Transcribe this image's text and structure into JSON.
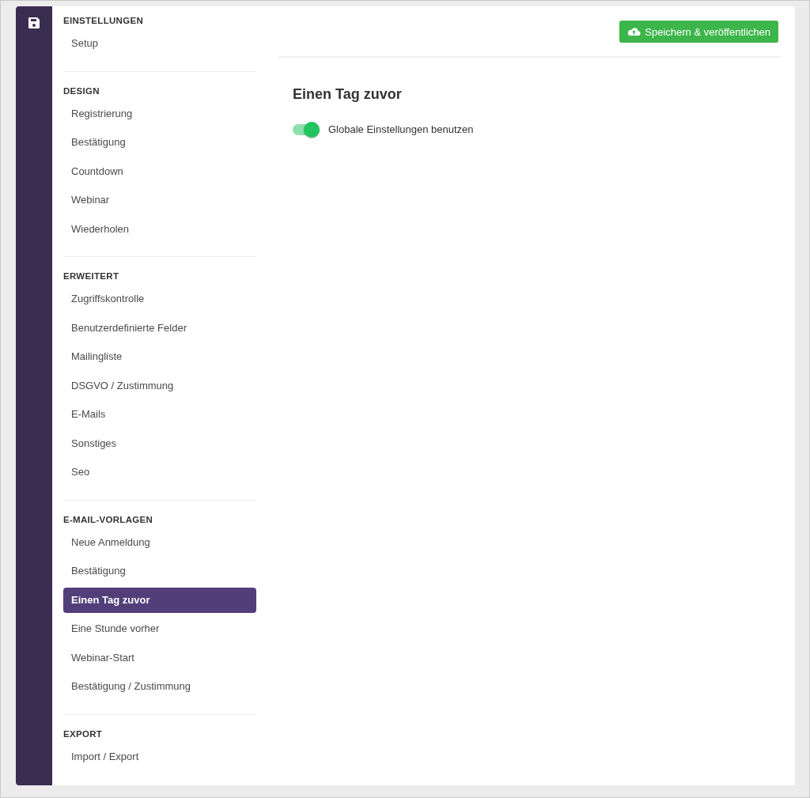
{
  "sections": [
    {
      "title": "EINSTELLUNGEN",
      "items": [
        {
          "label": "Setup",
          "selected": false
        }
      ]
    },
    {
      "title": "DESIGN",
      "items": [
        {
          "label": "Registrierung",
          "selected": false
        },
        {
          "label": "Bestätigung",
          "selected": false
        },
        {
          "label": "Countdown",
          "selected": false
        },
        {
          "label": "Webinar",
          "selected": false
        },
        {
          "label": "Wiederholen",
          "selected": false
        }
      ]
    },
    {
      "title": "ERWEITERT",
      "items": [
        {
          "label": "Zugriffskontrolle",
          "selected": false
        },
        {
          "label": "Benutzerdefinierte Felder",
          "selected": false
        },
        {
          "label": "Mailingliste",
          "selected": false
        },
        {
          "label": "DSGVO / Zustimmung",
          "selected": false
        },
        {
          "label": "E-Mails",
          "selected": false
        },
        {
          "label": "Sonstiges",
          "selected": false
        },
        {
          "label": "Seo",
          "selected": false
        }
      ]
    },
    {
      "title": "E-MAIL-VORLAGEN",
      "items": [
        {
          "label": "Neue Anmeldung",
          "selected": false
        },
        {
          "label": "Bestätigung",
          "selected": false
        },
        {
          "label": "Einen Tag zuvor",
          "selected": true
        },
        {
          "label": "Eine Stunde vorher",
          "selected": false
        },
        {
          "label": "Webinar-Start",
          "selected": false
        },
        {
          "label": "Bestätigung / Zustimmung",
          "selected": false
        }
      ]
    },
    {
      "title": "EXPORT",
      "items": [
        {
          "label": "Import / Export",
          "selected": false
        }
      ]
    }
  ],
  "save_button": "Speichern & veröffentlichen",
  "page_title": "Einen Tag zuvor",
  "toggle": {
    "label": "Globale Einstellungen benutzen",
    "on": true
  }
}
